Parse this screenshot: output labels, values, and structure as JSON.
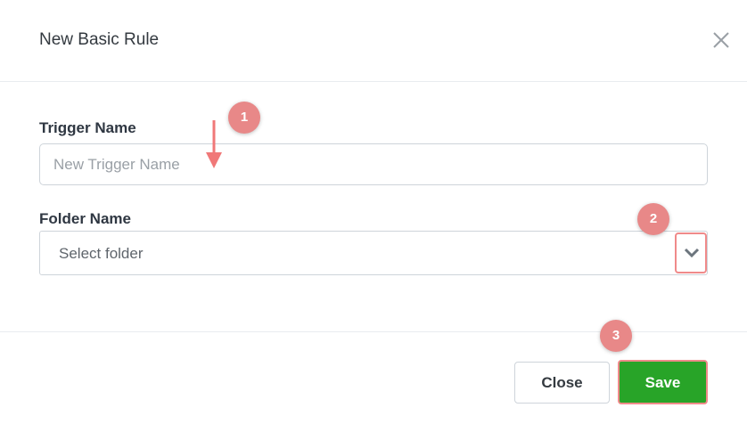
{
  "dialog": {
    "title": "New Basic Rule",
    "close_icon": "close-icon"
  },
  "form": {
    "trigger_name": {
      "label": "Trigger Name",
      "placeholder": "New Trigger Name",
      "value": ""
    },
    "folder_name": {
      "label": "Folder Name",
      "selected": "Select folder",
      "dropdown_icon": "chevron-down-icon"
    }
  },
  "footer": {
    "close_label": "Close",
    "save_label": "Save",
    "save_color": "#28a428"
  },
  "annotations": {
    "marker_color": "#e88888",
    "badges": [
      "1",
      "2",
      "3"
    ]
  }
}
